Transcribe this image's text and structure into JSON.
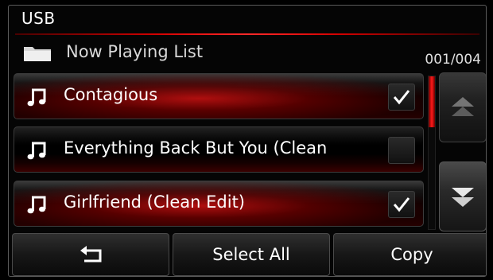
{
  "header": {
    "title": "USB"
  },
  "folder": {
    "icon": "folder-icon",
    "label": "Now Playing List"
  },
  "counter": "001/004",
  "items": [
    {
      "icon": "music-note-icon",
      "label": "Contagious",
      "checked": true
    },
    {
      "icon": "music-note-icon",
      "label": "Everything Back But You (Clean",
      "checked": false
    },
    {
      "icon": "music-note-icon",
      "label": "Girlfriend (Clean Edit)",
      "checked": true
    }
  ],
  "scroll": {
    "up_icon": "scroll-up-icon",
    "down_icon": "scroll-down-icon"
  },
  "footer": {
    "back_icon": "back-arrow-icon",
    "select_all_label": "Select All",
    "copy_label": "Copy"
  },
  "colors": {
    "accent": "#e01010",
    "background": "#000000"
  }
}
